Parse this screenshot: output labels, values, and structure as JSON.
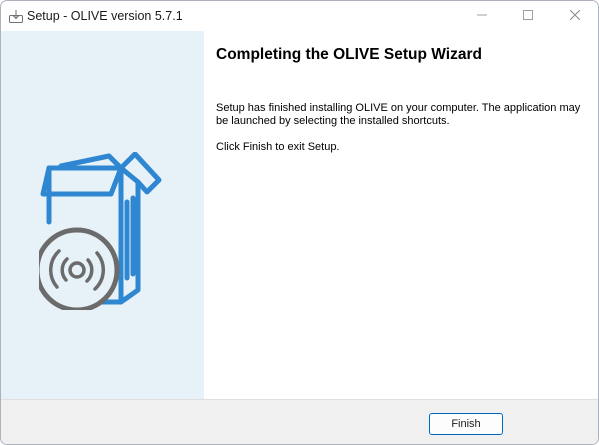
{
  "window": {
    "title": "Setup - OLIVE version 5.7.1",
    "icons": {
      "app": "setup-installer-icon",
      "minimize": "minimize-icon",
      "maximize": "maximize-icon",
      "close": "close-icon"
    }
  },
  "sidebar": {
    "illustration": "software-box-with-disc-icon",
    "accent_color": "#2f86d1",
    "disc_color": "#6b6b6b",
    "background": "#e7f1f8"
  },
  "main": {
    "heading": "Completing the OLIVE Setup Wizard",
    "paragraph_1": "Setup has finished installing OLIVE on your computer. The application may be launched by selecting the installed shortcuts.",
    "paragraph_2": "Click Finish to exit Setup."
  },
  "footer": {
    "finish_label": "Finish"
  }
}
